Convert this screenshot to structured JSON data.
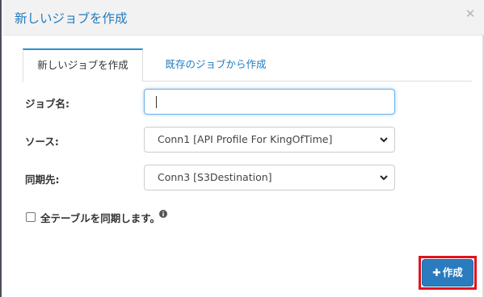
{
  "modal": {
    "title": "新しいジョブを作成",
    "close_icon": "close-icon"
  },
  "tabs": [
    {
      "label": "新しいジョブを作成",
      "active": true
    },
    {
      "label": "既存のジョブから作成",
      "active": false
    }
  ],
  "form": {
    "job_name": {
      "label": "ジョブ名:",
      "value": ""
    },
    "source": {
      "label": "ソース:",
      "selected": "Conn1 [API Profile For KingOfTime]"
    },
    "destination": {
      "label": "同期先:",
      "selected": "Conn3 [S3Destination]"
    },
    "sync_all_tables": {
      "label": "全テーブルを同期します。",
      "checked": false,
      "info_icon": "info-icon"
    }
  },
  "footer": {
    "create_button": {
      "icon": "plus-icon",
      "label": "作成"
    }
  },
  "colors": {
    "accent": "#1f7bbf",
    "button": "#2a7cbf",
    "highlight": "#e0131f"
  }
}
